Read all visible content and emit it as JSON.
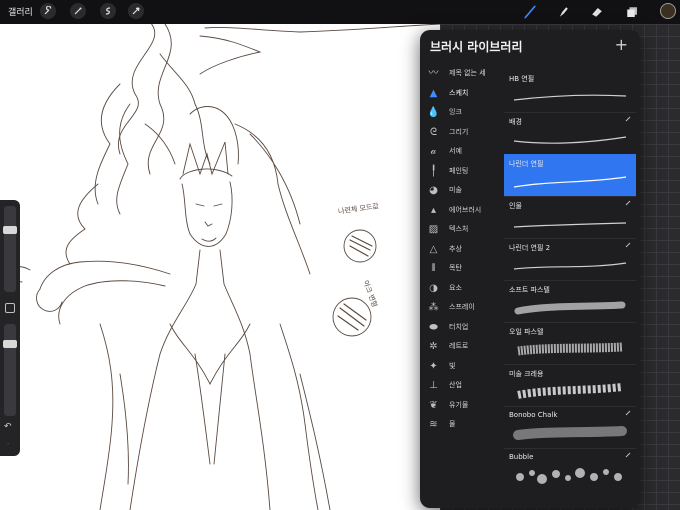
{
  "toolbar": {
    "gallery_label": "갤러리",
    "left_icons": [
      "wrench-icon",
      "magic-wand-icon",
      "selection-icon",
      "move-arrow-icon"
    ],
    "right_icons": [
      "brush-icon",
      "smudge-icon",
      "eraser-icon",
      "layers-icon",
      "color-swatch"
    ],
    "active_tool_color": "#3f8cff",
    "current_color": "#3b2f1f"
  },
  "canvas": {
    "annotation_1": "나련체 모드값",
    "annotation_2": "아크 변형"
  },
  "panel": {
    "title": "브러시 라이브러리",
    "add_label": "+",
    "categories": [
      {
        "label": "제목 없는 세",
        "icon": "squiggle-icon"
      },
      {
        "label": "스케치",
        "icon": "pencil-tip-icon"
      },
      {
        "label": "잉크",
        "icon": "ink-drop-icon"
      },
      {
        "label": "그리기",
        "icon": "drawing-icon"
      },
      {
        "label": "서예",
        "icon": "calligraphy-icon"
      },
      {
        "label": "페인팅",
        "icon": "paint-brush-icon"
      },
      {
        "label": "미술",
        "icon": "palette-icon"
      },
      {
        "label": "에어브러시",
        "icon": "airbrush-icon"
      },
      {
        "label": "텍스처",
        "icon": "texture-icon"
      },
      {
        "label": "추상",
        "icon": "triangle-icon"
      },
      {
        "label": "목탄",
        "icon": "charcoal-icon"
      },
      {
        "label": "요소",
        "icon": "element-icon"
      },
      {
        "label": "스프레이",
        "icon": "spray-icon"
      },
      {
        "label": "터치업",
        "icon": "touchup-icon"
      },
      {
        "label": "레트로",
        "icon": "retro-icon"
      },
      {
        "label": "빛",
        "icon": "sparkle-icon"
      },
      {
        "label": "산업",
        "icon": "anvil-icon"
      },
      {
        "label": "유기물",
        "icon": "leaf-icon"
      },
      {
        "label": "물",
        "icon": "water-icon"
      }
    ],
    "active_category": "스케치",
    "brushes": [
      {
        "name": "HB 연필",
        "style": "thin"
      },
      {
        "name": "배경",
        "style": "thin"
      },
      {
        "name": "나린더 연필",
        "style": "thin",
        "selected": true
      },
      {
        "name": "인물",
        "style": "thin"
      },
      {
        "name": "나린더 연필 2",
        "style": "thin"
      },
      {
        "name": "소프트 파스텔",
        "style": "pastel"
      },
      {
        "name": "오일 파스텔",
        "style": "oil"
      },
      {
        "name": "미술 크레용",
        "style": "crayon"
      },
      {
        "name": "Bonobo Chalk",
        "style": "chalk"
      },
      {
        "name": "Bubble",
        "style": "bubble"
      }
    ],
    "selected_color": "#2f76f0"
  }
}
